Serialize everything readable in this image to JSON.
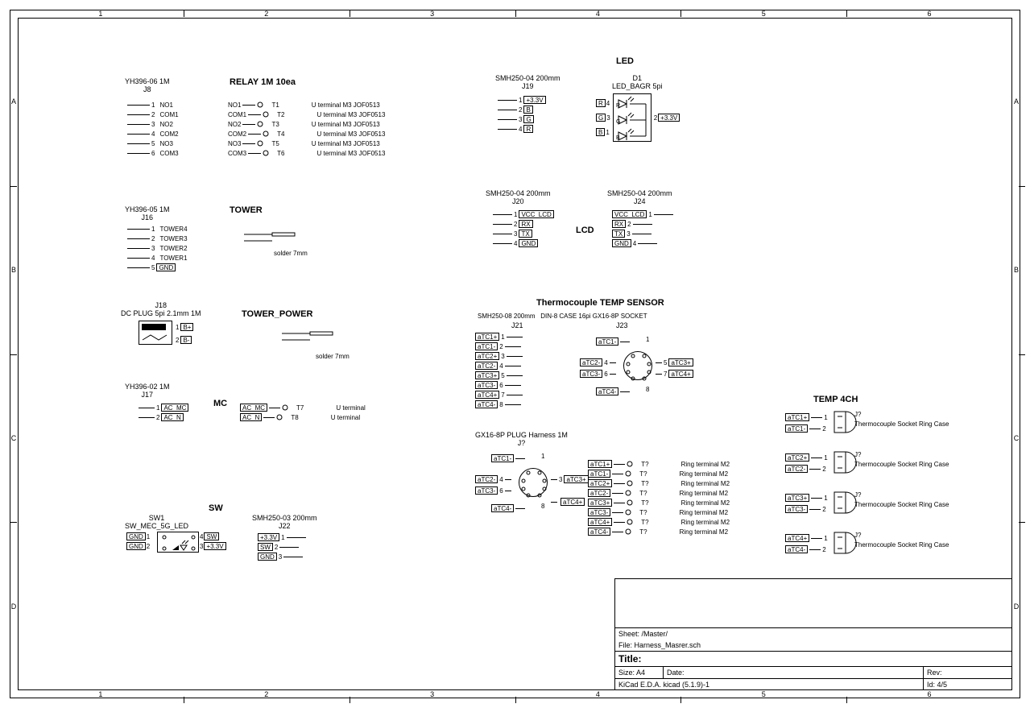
{
  "ruler_numbers": [
    "1",
    "2",
    "3",
    "4",
    "5",
    "6"
  ],
  "ruler_letters": [
    "A",
    "B",
    "C",
    "D"
  ],
  "relay": {
    "header": "RELAY 1M 10ea",
    "conn_top": "YH396-06 1M",
    "conn_ref": "J8",
    "pins": [
      "NO1",
      "COM1",
      "NO2",
      "COM2",
      "NO3",
      "COM3"
    ],
    "outputs": [
      "NO1",
      "COM1",
      "NO2",
      "COM2",
      "NO3",
      "COM3"
    ],
    "t": [
      "T1",
      "T2",
      "T3",
      "T4",
      "T5",
      "T6"
    ],
    "note": "U terminal M3 JOF0513"
  },
  "tower": {
    "header": "TOWER",
    "conn_top": "YH396-05 1M",
    "conn_ref": "J16",
    "pins": [
      "TOWER4",
      "TOWER3",
      "TOWER2",
      "TOWER1",
      "GND"
    ],
    "note": "solder 7mm"
  },
  "tower_power": {
    "header": "TOWER_POWER",
    "conn_top": "J18",
    "conn_sub": "DC PLUG 5pi 2.1mm 1M",
    "pins": [
      "B+",
      "B-"
    ],
    "note": "solder 7mm"
  },
  "mc": {
    "header": "MC",
    "conn_top": "YH396-02 1M",
    "conn_ref": "J17",
    "pins": [
      "AC_MC",
      "AC_N"
    ],
    "t": [
      "T7",
      "T8"
    ],
    "note": "U terminal"
  },
  "sw": {
    "header": "SW",
    "sw_top": "SW1",
    "sw_sub": "SW_MEC_5G_LED",
    "labels": [
      "GND",
      "SW",
      "+3.3V"
    ],
    "conn_top": "SMH250-03 200mm",
    "conn_ref": "J22",
    "pins": [
      "+3.3V",
      "SW",
      "GND"
    ]
  },
  "led": {
    "header": "LED",
    "conn_top": "SMH250-04 200mm",
    "conn_ref": "J19",
    "pins": [
      "+3.3V",
      "B",
      "G",
      "R"
    ],
    "d_top": "D1",
    "d_sub": "LED_BAGR 5pi",
    "d_labels": [
      "R",
      "G",
      "B",
      "+3.3V"
    ]
  },
  "lcd": {
    "header": "LCD",
    "conn1_top": "SMH250-04 200mm",
    "conn1_ref": "J20",
    "conn2_top": "SMH250-04 200mm",
    "conn2_ref": "J24",
    "pins": [
      "VCC_LCD",
      "RX",
      "TX",
      "GND"
    ]
  },
  "thermo": {
    "header": "Thermocouple TEMP SENSOR",
    "conn1_top": "SMH250-08 200mm",
    "conn1_ref": "J21",
    "conn2_top": "DIN-8 CASE 16pi GX16-8P SOCKET",
    "conn2_ref": "J23",
    "pins": [
      "aTC1+",
      "aTC1-",
      "aTC2+",
      "aTC2-",
      "aTC3+",
      "aTC3-",
      "aTC4+",
      "aTC4-"
    ],
    "plug_top": "GX16-8P PLUG Harness 1M",
    "plug_ref": "J?",
    "t_label": "T?",
    "note": "Ring terminal M2"
  },
  "temp4ch": {
    "header": "TEMP 4CH",
    "pairs": [
      [
        "aTC1+",
        "aTC1-"
      ],
      [
        "aTC2+",
        "aTC2-"
      ],
      [
        "aTC3+",
        "aTC3-"
      ],
      [
        "aTC4+",
        "aTC4-"
      ]
    ],
    "conn_ref": "J?",
    "note": "Thermocouple Socket Ring Case"
  },
  "title_block": {
    "sheet": "Sheet: /Master/",
    "file": "File: Harness_Masrer.sch",
    "title": "Title:",
    "size": "Size: A4",
    "date": "Date:",
    "rev": "Rev:",
    "tool": "KiCad E.D.A.  kicad (5.1.9)-1",
    "id": "Id: 4/5"
  }
}
